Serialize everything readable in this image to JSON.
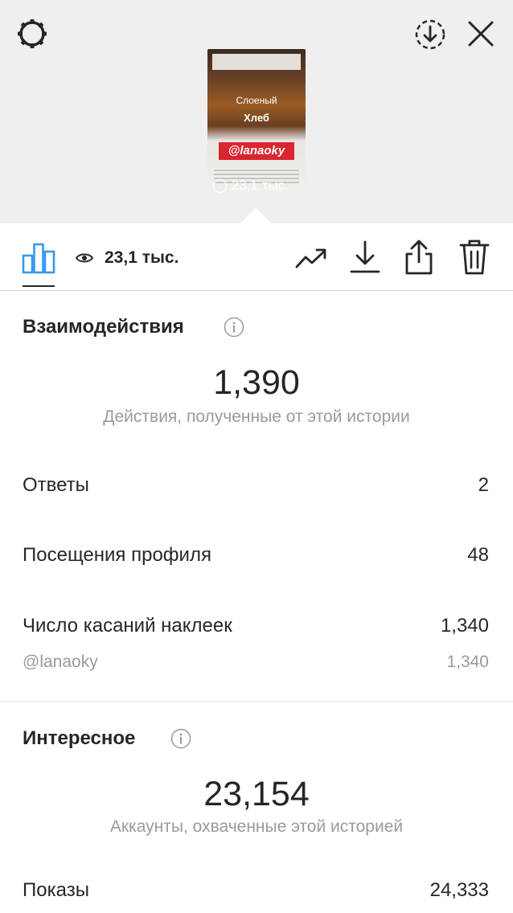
{
  "preview": {
    "thumb_text_line1": "Слоеный",
    "thumb_text_line2": "Хлеб",
    "thumb_tag": "@lanaoky",
    "thumb_views": "23,1 тыс."
  },
  "toolbar": {
    "views": "23,1 тыс."
  },
  "interactions": {
    "title": "Взаимодействия",
    "total": "1,390",
    "caption": "Действия, полученные от этой истории",
    "rows": [
      {
        "label": "Ответы",
        "value": "2"
      },
      {
        "label": "Посещения профиля",
        "value": "48"
      },
      {
        "label": "Число касаний наклеек",
        "value": "1,340"
      }
    ],
    "sticker": {
      "label": "@lanaoky",
      "value": "1,340"
    }
  },
  "discovery": {
    "title": "Интересное",
    "total": "23,154",
    "caption": "Аккаунты, охваченные этой историей",
    "rows": [
      {
        "label": "Показы",
        "value": "24,333"
      }
    ]
  },
  "icons": {
    "settings": "settings-gear-icon",
    "save_circle": "download-circle-icon",
    "close": "close-icon",
    "insights": "bar-chart-icon",
    "eye": "eye-icon",
    "promote": "trend-up-icon",
    "download": "download-icon",
    "share": "share-icon",
    "delete": "trash-icon",
    "info": "info-icon"
  }
}
